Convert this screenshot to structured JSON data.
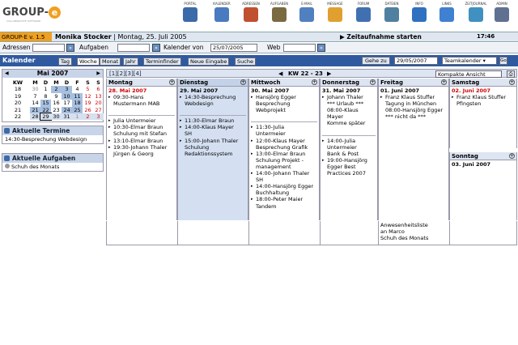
{
  "brand": {
    "name": "GROUP-",
    "e": "e",
    "tagline": "COLLABORATIVE SOFTWARE"
  },
  "nav": [
    {
      "label": "PORTAL",
      "icon": "portal-icon",
      "color": "#3a6aa8"
    },
    {
      "label": "KALENDER",
      "icon": "calendar-icon",
      "color": "#4a7ac0"
    },
    {
      "label": "ADRESSEN",
      "icon": "address-book-icon",
      "color": "#c05030"
    },
    {
      "label": "AUFGABEN",
      "icon": "tasks-icon",
      "color": "#7a6a40"
    },
    {
      "label": "E-MAIL",
      "icon": "email-icon",
      "color": "#5080c0"
    },
    {
      "label": "MESSAGE",
      "icon": "message-icon",
      "color": "#e0a030"
    },
    {
      "label": "FORUM",
      "icon": "forum-icon",
      "color": "#4070b0"
    },
    {
      "label": "DATEIEN",
      "icon": "files-icon",
      "color": "#5080a0"
    },
    {
      "label": "INFO",
      "icon": "info-icon",
      "color": "#3070c0"
    },
    {
      "label": "LINKS",
      "icon": "star-icon",
      "color": "#4080d0"
    },
    {
      "label": "ZEITJOURNAL",
      "icon": "clock-icon",
      "color": "#4090c0"
    },
    {
      "label": "ADMIN",
      "icon": "admin-icon",
      "color": "#607090"
    }
  ],
  "status": {
    "version": "GROUP-E v. 1.5",
    "user": "Monika Stocker",
    "date": "Montag, 25. Juli 2005",
    "time_tracking": "Zeitaufnahme starten",
    "clock": "17:46"
  },
  "search": {
    "address_label": "Adressen",
    "tasks_label": "Aufgaben",
    "calendar_label": "Kalender von",
    "calendar_value": "25/07/2005",
    "web_label": "Web"
  },
  "module": {
    "title": "Kalender",
    "tabs": [
      "Tag",
      "Woche",
      "Monat",
      "Jahr",
      "Terminfinder",
      "Neue Eingabe",
      "Suche"
    ],
    "active_tab": "Woche",
    "goto_label": "Gehe zu",
    "goto_date": "29/05/2007",
    "view_select": "Teamkalender"
  },
  "minical": {
    "title": "Mai 2007",
    "headers": [
      "KW",
      "M",
      "D",
      "M",
      "D",
      "F",
      "S",
      "S"
    ],
    "weeks": [
      {
        "kw": "18",
        "days": [
          "30",
          "1",
          "2",
          "3",
          "4",
          "5",
          "6"
        ]
      },
      {
        "kw": "19",
        "days": [
          "7",
          "8",
          "9",
          "10",
          "11",
          "12",
          "13"
        ]
      },
      {
        "kw": "20",
        "days": [
          "14",
          "15",
          "16",
          "17",
          "18",
          "19",
          "20"
        ]
      },
      {
        "kw": "21",
        "days": [
          "21",
          "22",
          "23",
          "24",
          "25",
          "26",
          "27"
        ]
      },
      {
        "kw": "22",
        "days": [
          "28",
          "29",
          "30",
          "31",
          "1",
          "2",
          "3"
        ]
      }
    ]
  },
  "termine": {
    "title": "Aktuelle Termine",
    "items": [
      "14:30-Besprechung Webdesign"
    ]
  },
  "aufgaben": {
    "title": "Aktuelle Aufgaben",
    "items": [
      "Schuh des Monats"
    ]
  },
  "calendar": {
    "pages": "[1][2][3][4]",
    "kw_label": "KW 22 - 23",
    "view": "Kompakte Ansicht",
    "days": [
      {
        "name": "Montag",
        "date": "28. Mai 2007",
        "red": true,
        "top": "09:30-Hans\nMustermann MAB",
        "bottom": [
          "Julia Untermeier",
          "10:30-Elmar Braun\nSchulung mit Stefan",
          "13:10-Elmar Braun",
          "19:30-Johann Thaler\nJürgen & Georg"
        ],
        "extra": ""
      },
      {
        "name": "Dienstag",
        "date": "29. Mai 2007",
        "red": false,
        "top": "14:30-Besprechung\nWebdesign",
        "bottom": [
          "11:30-Elmar Braun",
          "14:00-Klaus Mayer\nSH",
          "15:00-Johann Thaler\nSchulung\nRedaktionssystem"
        ],
        "extra": ""
      },
      {
        "name": "Mittwoch",
        "date": "30. Mai 2007",
        "red": false,
        "top": "Hansjörg Egger\nBesprechung\nWebprojekt",
        "bottom": [
          "11:30-Julia\nUntermeier",
          "12:00-Klaus Mayer\nBesprechung Grafik",
          "13:00-Elmar Braun\nSchulung Projekt -\nmanagement",
          "14:00-Johann Thaler\nSH",
          "14:00-Hansjörg Egger\nBuchhaltung",
          "18:00-Peter Maier\nTandem"
        ],
        "extra": ""
      },
      {
        "name": "Donnerstag",
        "date": "31. Mai 2007",
        "red": false,
        "top": "Johann Thaler\n*** Urlaub ***\n08:00-Klaus\nMayer\nKomme später",
        "bottom": [
          "14:00-Julia\nUntermeier\nBank & Post",
          "19:00-Hansjörg\nEgger Best\nPractices 2007"
        ],
        "extra": ""
      },
      {
        "name": "Freitag",
        "date": "01. Juni 2007",
        "red": false,
        "top": "Franz Klaus Stuffer\nTagung in München\n08:00-Hansjörg Egger\n*** nicht da ***",
        "bottom": [],
        "extra": "Anwesenheitsliste\nan Marco\nSchuh des Monats"
      },
      {
        "name": "Samstag",
        "date": "02. Juni 2007",
        "red": true,
        "top": "Franz Klaus Stuffer\nPfingsten",
        "bottom": [],
        "extra": ""
      },
      {
        "name": "Sonntag",
        "date": "03. Juni 2007",
        "red": false,
        "top": "",
        "bottom": [],
        "extra": ""
      }
    ]
  }
}
